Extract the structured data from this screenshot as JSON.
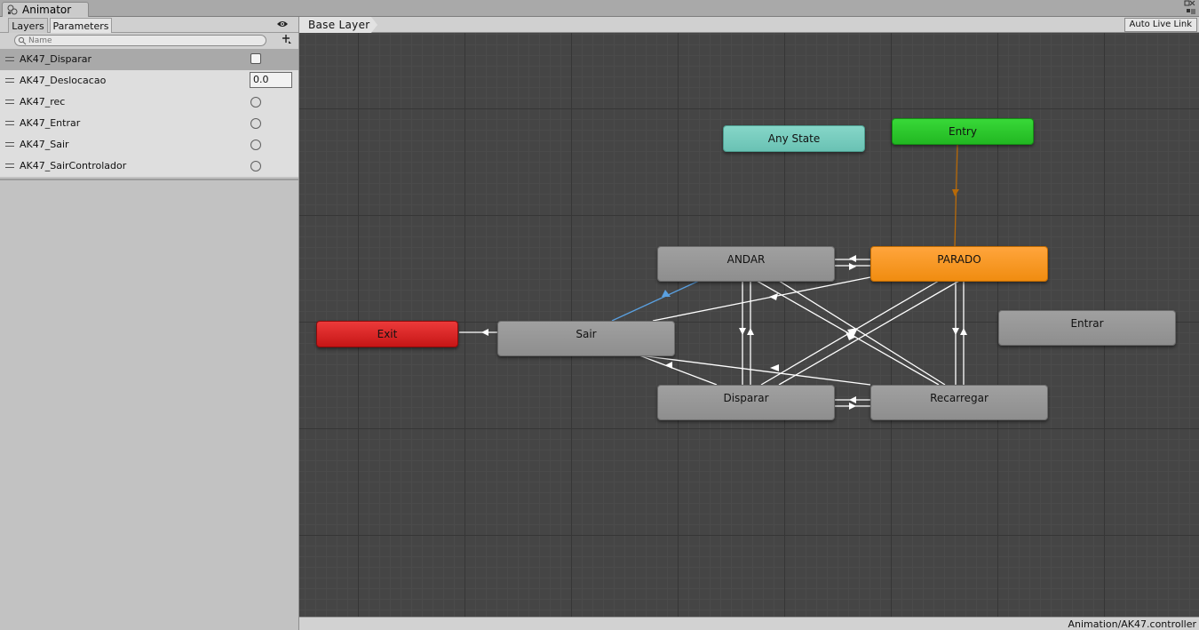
{
  "window": {
    "title": "Animator",
    "icon": "animator-icon"
  },
  "left_panel": {
    "tabs": [
      {
        "label": "Layers"
      },
      {
        "label": "Parameters"
      }
    ],
    "search_placeholder": "Name",
    "parameters": [
      {
        "name": "AK47_Disparar",
        "type": "bool",
        "selected": true
      },
      {
        "name": "AK47_Deslocacao",
        "type": "float",
        "value": "0.0"
      },
      {
        "name": "AK47_rec",
        "type": "trigger"
      },
      {
        "name": "AK47_Entrar",
        "type": "trigger"
      },
      {
        "name": "AK47_Sair",
        "type": "trigger"
      },
      {
        "name": "AK47_SairControlador",
        "type": "trigger"
      }
    ]
  },
  "graph": {
    "breadcrumb": "Base Layer",
    "live_link_label": "Auto Live Link",
    "states": {
      "any_state": "Any State",
      "entry": "Entry",
      "exit": "Exit",
      "andar": "ANDAR",
      "parado": "PARADO",
      "sair": "Sair",
      "entrar": "Entrar",
      "disparar": "Disparar",
      "recarregar": "Recarregar"
    },
    "colors": {
      "default_state": "#999999",
      "default_state_node": "#f49a26",
      "entry": "#2ec82e",
      "exit": "#d92828",
      "any_state": "#78ccbe",
      "transition": "#ffffff",
      "entry_transition": "#b86a08",
      "selected_transition": "#5aa0e0"
    }
  },
  "status_bar": {
    "path": "Animation/AK47.controller"
  }
}
